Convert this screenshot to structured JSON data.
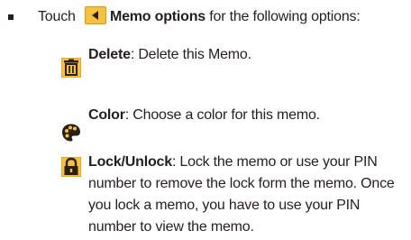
{
  "intro": {
    "prefix": "Touch",
    "button_name": "Memo options",
    "suffix": "for the following options:"
  },
  "options": [
    {
      "icon": "trash-icon",
      "title": "Delete",
      "desc": ": Delete this Memo."
    },
    {
      "icon": "palette-icon",
      "title": "Color",
      "desc": ": Choose a color for this memo."
    },
    {
      "icon": "lock-icon",
      "title": "Lock/Unlock",
      "desc": ": Lock the memo or use your PIN number to remove the lock form the memo. Once you lock a memo, you have to use your PIN number to view the memo."
    }
  ],
  "colors": {
    "icon_fill": "#f6c23e",
    "icon_border": "#d49a10",
    "icon_dark": "#2b1e14",
    "text": "#231f20"
  }
}
